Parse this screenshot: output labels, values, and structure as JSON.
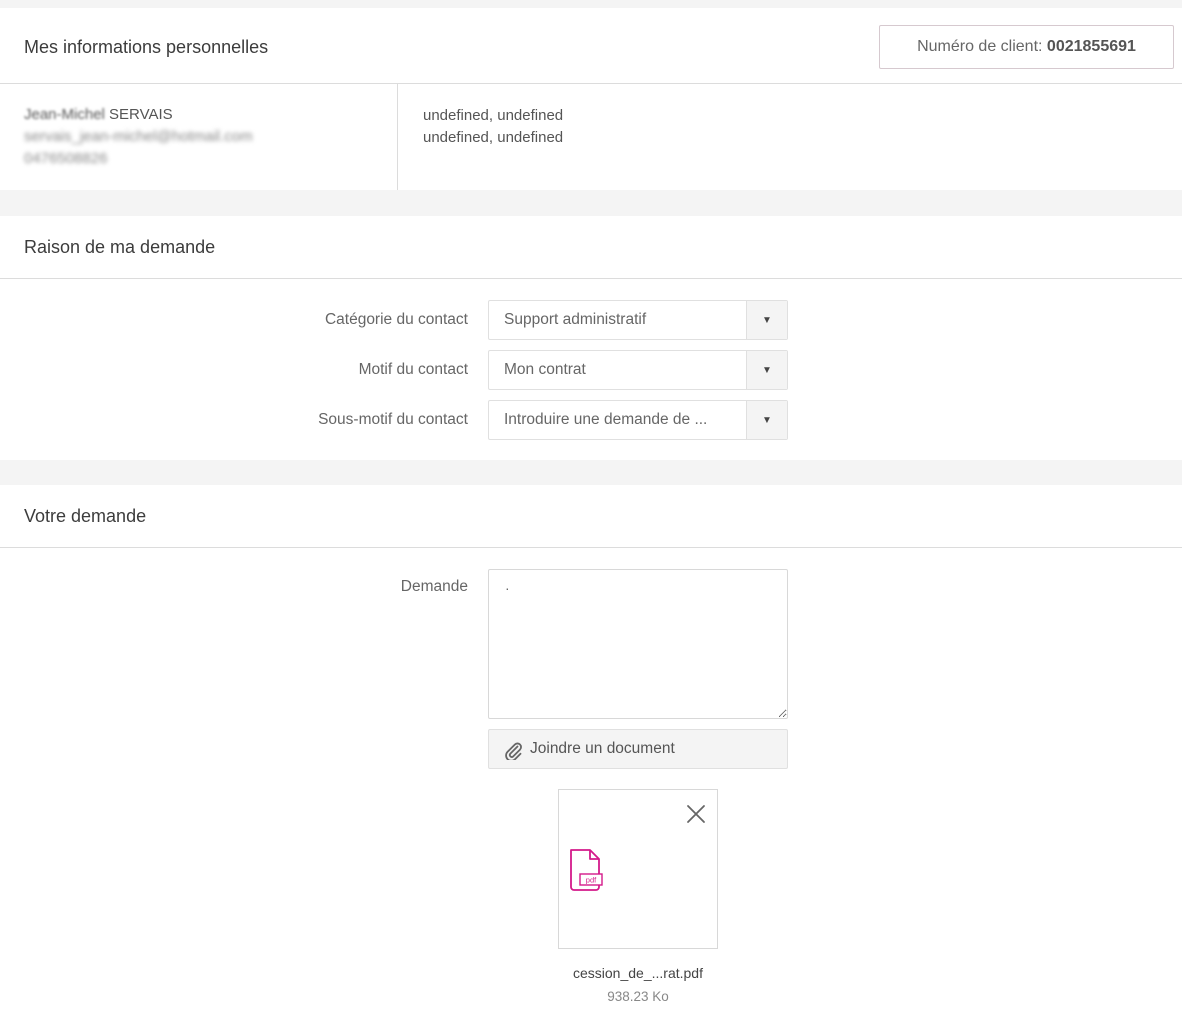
{
  "personal": {
    "title": "Mes informations personnelles",
    "client_label": "Numéro de client: ",
    "client_number": "0021855691",
    "name_first": "Jean-Michel",
    "name_last": "SERVAIS",
    "email": "servais_jean-michel@hotmail.com",
    "phone": "0476508826",
    "address_line1": "undefined, undefined",
    "address_line2": "undefined, undefined"
  },
  "reason": {
    "title": "Raison de ma demande",
    "fields": [
      {
        "label": "Catégorie du contact",
        "value": "Support administratif"
      },
      {
        "label": "Motif du contact",
        "value": "Mon contrat"
      },
      {
        "label": "Sous-motif du contact",
        "value": "Introduire une demande de ..."
      }
    ],
    "arrow_glyph": "▼"
  },
  "request": {
    "title": "Votre demande",
    "demande_label": "Demande",
    "demande_value": "·",
    "attach_label": "Joindre un document",
    "file": {
      "name": "cession_de_...rat.pdf",
      "size": "938.23 Ko",
      "icon_tag": "pdf"
    }
  },
  "colors": {
    "accent_pdf": "#d4198a",
    "page_bg": "#f4f4f4"
  },
  "icons": {
    "attach": "paperclip-icon",
    "remove": "close-icon",
    "file": "pdf-file-icon",
    "dropdown": "chevron-down-icon"
  }
}
